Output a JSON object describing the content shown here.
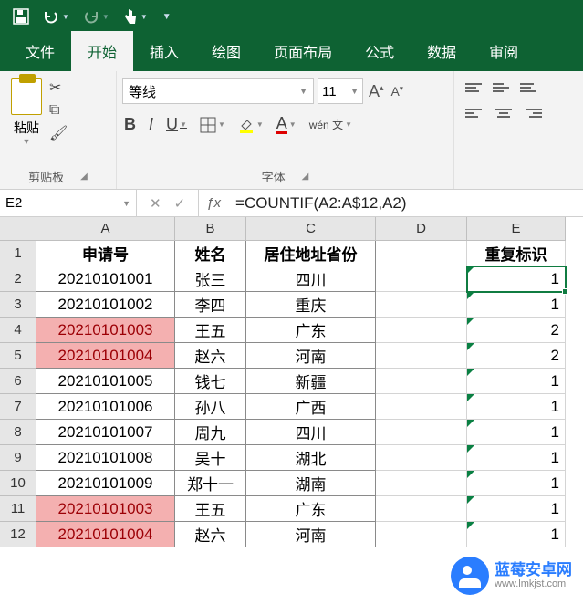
{
  "qat": {
    "save_icon": "save-icon",
    "undo_icon": "undo-icon",
    "redo_icon": "redo-icon",
    "touch_icon": "touch-mode-icon",
    "customize_icon": "customize-qat-icon"
  },
  "tabs": {
    "file": "文件",
    "home": "开始",
    "insert": "插入",
    "draw": "绘图",
    "layout": "页面布局",
    "formulas": "公式",
    "data": "数据",
    "review": "审阅"
  },
  "ribbon": {
    "clipboard": {
      "paste_label": "粘贴",
      "group_label": "剪贴板"
    },
    "font": {
      "name": "等线",
      "size": "11",
      "group_label": "字体",
      "bold": "B",
      "italic": "I",
      "underline": "U",
      "phonetic": "wén 文"
    }
  },
  "formula_bar": {
    "name_box": "E2",
    "formula": "=COUNTIF(A2:A$12,A2)"
  },
  "columns": [
    "A",
    "B",
    "C",
    "D",
    "E"
  ],
  "headers": {
    "A": "申请号",
    "B": "姓名",
    "C": "居住地址省份",
    "E": "重复标识"
  },
  "rows": [
    {
      "n": 1
    },
    {
      "n": 2,
      "A": "20210101001",
      "B": "张三",
      "C": "四川",
      "E": "1"
    },
    {
      "n": 3,
      "A": "20210101002",
      "B": "李四",
      "C": "重庆",
      "E": "1"
    },
    {
      "n": 4,
      "A": "20210101003",
      "B": "王五",
      "C": "广东",
      "E": "2",
      "dup": true
    },
    {
      "n": 5,
      "A": "20210101004",
      "B": "赵六",
      "C": "河南",
      "E": "2",
      "dup": true
    },
    {
      "n": 6,
      "A": "20210101005",
      "B": "钱七",
      "C": "新疆",
      "E": "1"
    },
    {
      "n": 7,
      "A": "20210101006",
      "B": "孙八",
      "C": "广西",
      "E": "1"
    },
    {
      "n": 8,
      "A": "20210101007",
      "B": "周九",
      "C": "四川",
      "E": "1"
    },
    {
      "n": 9,
      "A": "20210101008",
      "B": "吴十",
      "C": "湖北",
      "E": "1"
    },
    {
      "n": 10,
      "A": "20210101009",
      "B": "郑十一",
      "C": "湖南",
      "E": "1"
    },
    {
      "n": 11,
      "A": "20210101003",
      "B": "王五",
      "C": "广东",
      "E": "1",
      "dup": true
    },
    {
      "n": 12,
      "A": "20210101004",
      "B": "赵六",
      "C": "河南",
      "E": "1",
      "dup": true
    }
  ],
  "selected_cell": "E2",
  "watermark": {
    "title": "蓝莓安卓网",
    "sub": "www.lmkjst.com"
  }
}
